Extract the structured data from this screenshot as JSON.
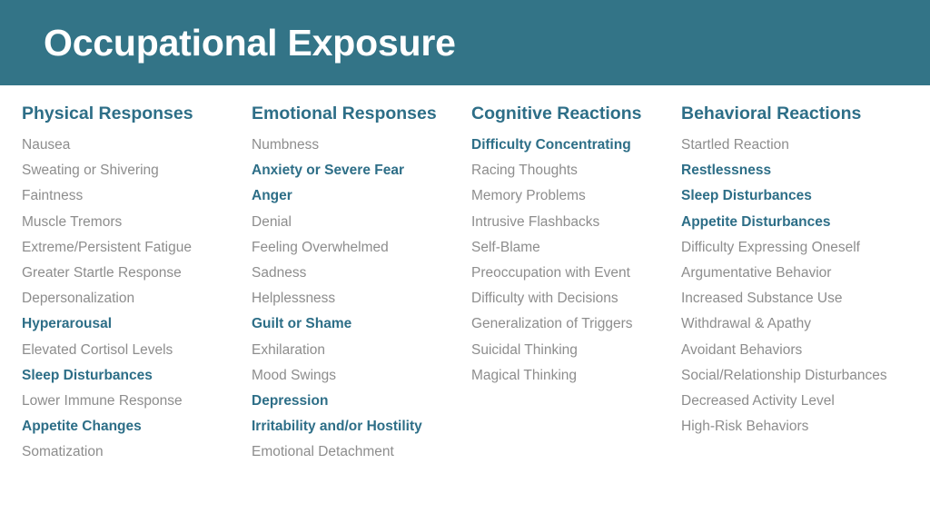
{
  "slide": {
    "title": "Occupational Exposure",
    "band_color": "#337487",
    "accent_color": "#2d6e87",
    "body_text_color": "#8d8d8d",
    "background_color": "#ffffff"
  },
  "columns": [
    {
      "header": "Physical Responses",
      "items": [
        {
          "label": "Nausea",
          "highlight": false
        },
        {
          "label": "Sweating or Shivering",
          "highlight": false
        },
        {
          "label": "Faintness",
          "highlight": false
        },
        {
          "label": "Muscle Tremors",
          "highlight": false
        },
        {
          "label": "Extreme/Persistent Fatigue",
          "highlight": false
        },
        {
          "label": "Greater Startle Response",
          "highlight": false
        },
        {
          "label": "Depersonalization",
          "highlight": false
        },
        {
          "label": "Hyperarousal",
          "highlight": true
        },
        {
          "label": "Elevated Cortisol Levels",
          "highlight": false
        },
        {
          "label": "Sleep Disturbances",
          "highlight": true
        },
        {
          "label": "Lower Immune Response",
          "highlight": false
        },
        {
          "label": "Appetite Changes",
          "highlight": true
        },
        {
          "label": "Somatization",
          "highlight": false
        }
      ]
    },
    {
      "header": "Emotional Responses",
      "items": [
        {
          "label": "Numbness",
          "highlight": false
        },
        {
          "label": "Anxiety or Severe Fear",
          "highlight": true
        },
        {
          "label": "Anger",
          "highlight": true
        },
        {
          "label": "Denial",
          "highlight": false
        },
        {
          "label": "Feeling Overwhelmed",
          "highlight": false
        },
        {
          "label": "Sadness",
          "highlight": false
        },
        {
          "label": "Helplessness",
          "highlight": false
        },
        {
          "label": "Guilt or Shame",
          "highlight": true
        },
        {
          "label": "Exhilaration",
          "highlight": false
        },
        {
          "label": "Mood Swings",
          "highlight": false
        },
        {
          "label": "Depression",
          "highlight": true
        },
        {
          "label": "Irritability and/or Hostility",
          "highlight": true
        },
        {
          "label": "Emotional Detachment",
          "highlight": false
        }
      ]
    },
    {
      "header": "Cognitive Reactions",
      "items": [
        {
          "label": "Difficulty Concentrating",
          "highlight": true
        },
        {
          "label": "Racing Thoughts",
          "highlight": false
        },
        {
          "label": "Memory Problems",
          "highlight": false
        },
        {
          "label": "Intrusive Flashbacks",
          "highlight": false
        },
        {
          "label": "Self-Blame",
          "highlight": false
        },
        {
          "label": "Preoccupation with Event",
          "highlight": false
        },
        {
          "label": "Difficulty with Decisions",
          "highlight": false
        },
        {
          "label": "Generalization of Triggers",
          "highlight": false
        },
        {
          "label": "Suicidal Thinking",
          "highlight": false
        },
        {
          "label": "Magical Thinking",
          "highlight": false
        }
      ]
    },
    {
      "header": "Behavioral Reactions",
      "items": [
        {
          "label": "Startled Reaction",
          "highlight": false
        },
        {
          "label": "Restlessness",
          "highlight": true
        },
        {
          "label": "Sleep Disturbances",
          "highlight": true
        },
        {
          "label": "Appetite Disturbances",
          "highlight": true
        },
        {
          "label": "Difficulty Expressing Oneself",
          "highlight": false
        },
        {
          "label": "Argumentative Behavior",
          "highlight": false
        },
        {
          "label": "Increased Substance Use",
          "highlight": false
        },
        {
          "label": "Withdrawal & Apathy",
          "highlight": false
        },
        {
          "label": "Avoidant Behaviors",
          "highlight": false
        },
        {
          "label": "Social/Relationship Disturbances",
          "highlight": false
        },
        {
          "label": "Decreased Activity Level",
          "highlight": false
        },
        {
          "label": "High-Risk Behaviors",
          "highlight": false
        }
      ]
    }
  ]
}
